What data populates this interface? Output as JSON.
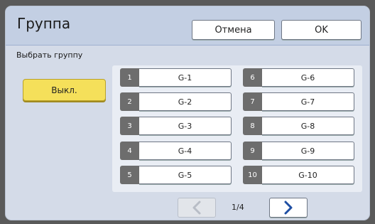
{
  "dialog": {
    "title": "Группа",
    "cancel_label": "Отмена",
    "ok_label": "OK",
    "subtitle": "Выбрать группу",
    "off_label": "Выкл."
  },
  "groups": [
    {
      "num": "1",
      "label": "G-1"
    },
    {
      "num": "2",
      "label": "G-2"
    },
    {
      "num": "3",
      "label": "G-3"
    },
    {
      "num": "4",
      "label": "G-4"
    },
    {
      "num": "5",
      "label": "G-5"
    },
    {
      "num": "6",
      "label": "G-6"
    },
    {
      "num": "7",
      "label": "G-7"
    },
    {
      "num": "8",
      "label": "G-8"
    },
    {
      "num": "9",
      "label": "G-9"
    },
    {
      "num": "10",
      "label": "G-10"
    }
  ],
  "pager": {
    "text": "1/4",
    "prev_enabled": false,
    "next_enabled": true
  },
  "icons": {
    "prev": "chevron-left-icon",
    "next": "chevron-right-icon"
  },
  "colors": {
    "off_button": "#f5e05a",
    "group_number_bg": "#6d6d6d",
    "header_bg": "#c3cfe3"
  }
}
